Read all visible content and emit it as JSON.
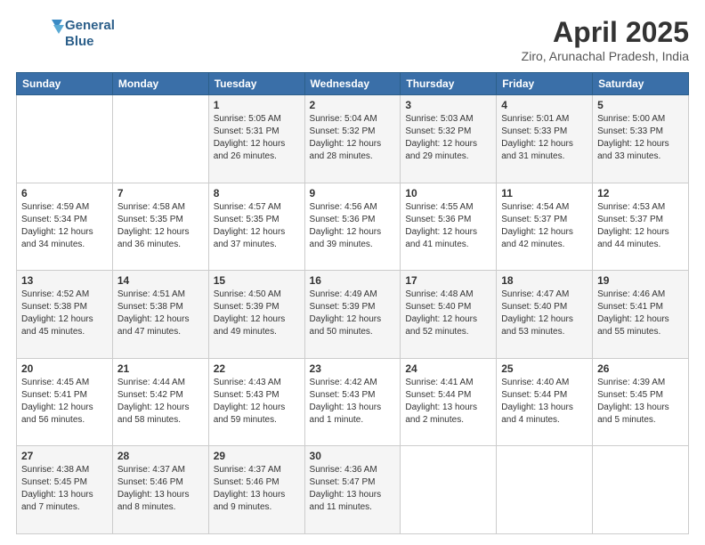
{
  "header": {
    "logo_line1": "General",
    "logo_line2": "Blue",
    "title": "April 2025",
    "subtitle": "Ziro, Arunachal Pradesh, India"
  },
  "columns": [
    "Sunday",
    "Monday",
    "Tuesday",
    "Wednesday",
    "Thursday",
    "Friday",
    "Saturday"
  ],
  "weeks": [
    [
      {
        "day": "",
        "sunrise": "",
        "sunset": "",
        "daylight": ""
      },
      {
        "day": "",
        "sunrise": "",
        "sunset": "",
        "daylight": ""
      },
      {
        "day": "1",
        "sunrise": "Sunrise: 5:05 AM",
        "sunset": "Sunset: 5:31 PM",
        "daylight": "Daylight: 12 hours and 26 minutes."
      },
      {
        "day": "2",
        "sunrise": "Sunrise: 5:04 AM",
        "sunset": "Sunset: 5:32 PM",
        "daylight": "Daylight: 12 hours and 28 minutes."
      },
      {
        "day": "3",
        "sunrise": "Sunrise: 5:03 AM",
        "sunset": "Sunset: 5:32 PM",
        "daylight": "Daylight: 12 hours and 29 minutes."
      },
      {
        "day": "4",
        "sunrise": "Sunrise: 5:01 AM",
        "sunset": "Sunset: 5:33 PM",
        "daylight": "Daylight: 12 hours and 31 minutes."
      },
      {
        "day": "5",
        "sunrise": "Sunrise: 5:00 AM",
        "sunset": "Sunset: 5:33 PM",
        "daylight": "Daylight: 12 hours and 33 minutes."
      }
    ],
    [
      {
        "day": "6",
        "sunrise": "Sunrise: 4:59 AM",
        "sunset": "Sunset: 5:34 PM",
        "daylight": "Daylight: 12 hours and 34 minutes."
      },
      {
        "day": "7",
        "sunrise": "Sunrise: 4:58 AM",
        "sunset": "Sunset: 5:35 PM",
        "daylight": "Daylight: 12 hours and 36 minutes."
      },
      {
        "day": "8",
        "sunrise": "Sunrise: 4:57 AM",
        "sunset": "Sunset: 5:35 PM",
        "daylight": "Daylight: 12 hours and 37 minutes."
      },
      {
        "day": "9",
        "sunrise": "Sunrise: 4:56 AM",
        "sunset": "Sunset: 5:36 PM",
        "daylight": "Daylight: 12 hours and 39 minutes."
      },
      {
        "day": "10",
        "sunrise": "Sunrise: 4:55 AM",
        "sunset": "Sunset: 5:36 PM",
        "daylight": "Daylight: 12 hours and 41 minutes."
      },
      {
        "day": "11",
        "sunrise": "Sunrise: 4:54 AM",
        "sunset": "Sunset: 5:37 PM",
        "daylight": "Daylight: 12 hours and 42 minutes."
      },
      {
        "day": "12",
        "sunrise": "Sunrise: 4:53 AM",
        "sunset": "Sunset: 5:37 PM",
        "daylight": "Daylight: 12 hours and 44 minutes."
      }
    ],
    [
      {
        "day": "13",
        "sunrise": "Sunrise: 4:52 AM",
        "sunset": "Sunset: 5:38 PM",
        "daylight": "Daylight: 12 hours and 45 minutes."
      },
      {
        "day": "14",
        "sunrise": "Sunrise: 4:51 AM",
        "sunset": "Sunset: 5:38 PM",
        "daylight": "Daylight: 12 hours and 47 minutes."
      },
      {
        "day": "15",
        "sunrise": "Sunrise: 4:50 AM",
        "sunset": "Sunset: 5:39 PM",
        "daylight": "Daylight: 12 hours and 49 minutes."
      },
      {
        "day": "16",
        "sunrise": "Sunrise: 4:49 AM",
        "sunset": "Sunset: 5:39 PM",
        "daylight": "Daylight: 12 hours and 50 minutes."
      },
      {
        "day": "17",
        "sunrise": "Sunrise: 4:48 AM",
        "sunset": "Sunset: 5:40 PM",
        "daylight": "Daylight: 12 hours and 52 minutes."
      },
      {
        "day": "18",
        "sunrise": "Sunrise: 4:47 AM",
        "sunset": "Sunset: 5:40 PM",
        "daylight": "Daylight: 12 hours and 53 minutes."
      },
      {
        "day": "19",
        "sunrise": "Sunrise: 4:46 AM",
        "sunset": "Sunset: 5:41 PM",
        "daylight": "Daylight: 12 hours and 55 minutes."
      }
    ],
    [
      {
        "day": "20",
        "sunrise": "Sunrise: 4:45 AM",
        "sunset": "Sunset: 5:41 PM",
        "daylight": "Daylight: 12 hours and 56 minutes."
      },
      {
        "day": "21",
        "sunrise": "Sunrise: 4:44 AM",
        "sunset": "Sunset: 5:42 PM",
        "daylight": "Daylight: 12 hours and 58 minutes."
      },
      {
        "day": "22",
        "sunrise": "Sunrise: 4:43 AM",
        "sunset": "Sunset: 5:43 PM",
        "daylight": "Daylight: 12 hours and 59 minutes."
      },
      {
        "day": "23",
        "sunrise": "Sunrise: 4:42 AM",
        "sunset": "Sunset: 5:43 PM",
        "daylight": "Daylight: 13 hours and 1 minute."
      },
      {
        "day": "24",
        "sunrise": "Sunrise: 4:41 AM",
        "sunset": "Sunset: 5:44 PM",
        "daylight": "Daylight: 13 hours and 2 minutes."
      },
      {
        "day": "25",
        "sunrise": "Sunrise: 4:40 AM",
        "sunset": "Sunset: 5:44 PM",
        "daylight": "Daylight: 13 hours and 4 minutes."
      },
      {
        "day": "26",
        "sunrise": "Sunrise: 4:39 AM",
        "sunset": "Sunset: 5:45 PM",
        "daylight": "Daylight: 13 hours and 5 minutes."
      }
    ],
    [
      {
        "day": "27",
        "sunrise": "Sunrise: 4:38 AM",
        "sunset": "Sunset: 5:45 PM",
        "daylight": "Daylight: 13 hours and 7 minutes."
      },
      {
        "day": "28",
        "sunrise": "Sunrise: 4:37 AM",
        "sunset": "Sunset: 5:46 PM",
        "daylight": "Daylight: 13 hours and 8 minutes."
      },
      {
        "day": "29",
        "sunrise": "Sunrise: 4:37 AM",
        "sunset": "Sunset: 5:46 PM",
        "daylight": "Daylight: 13 hours and 9 minutes."
      },
      {
        "day": "30",
        "sunrise": "Sunrise: 4:36 AM",
        "sunset": "Sunset: 5:47 PM",
        "daylight": "Daylight: 13 hours and 11 minutes."
      },
      {
        "day": "",
        "sunrise": "",
        "sunset": "",
        "daylight": ""
      },
      {
        "day": "",
        "sunrise": "",
        "sunset": "",
        "daylight": ""
      },
      {
        "day": "",
        "sunrise": "",
        "sunset": "",
        "daylight": ""
      }
    ]
  ]
}
